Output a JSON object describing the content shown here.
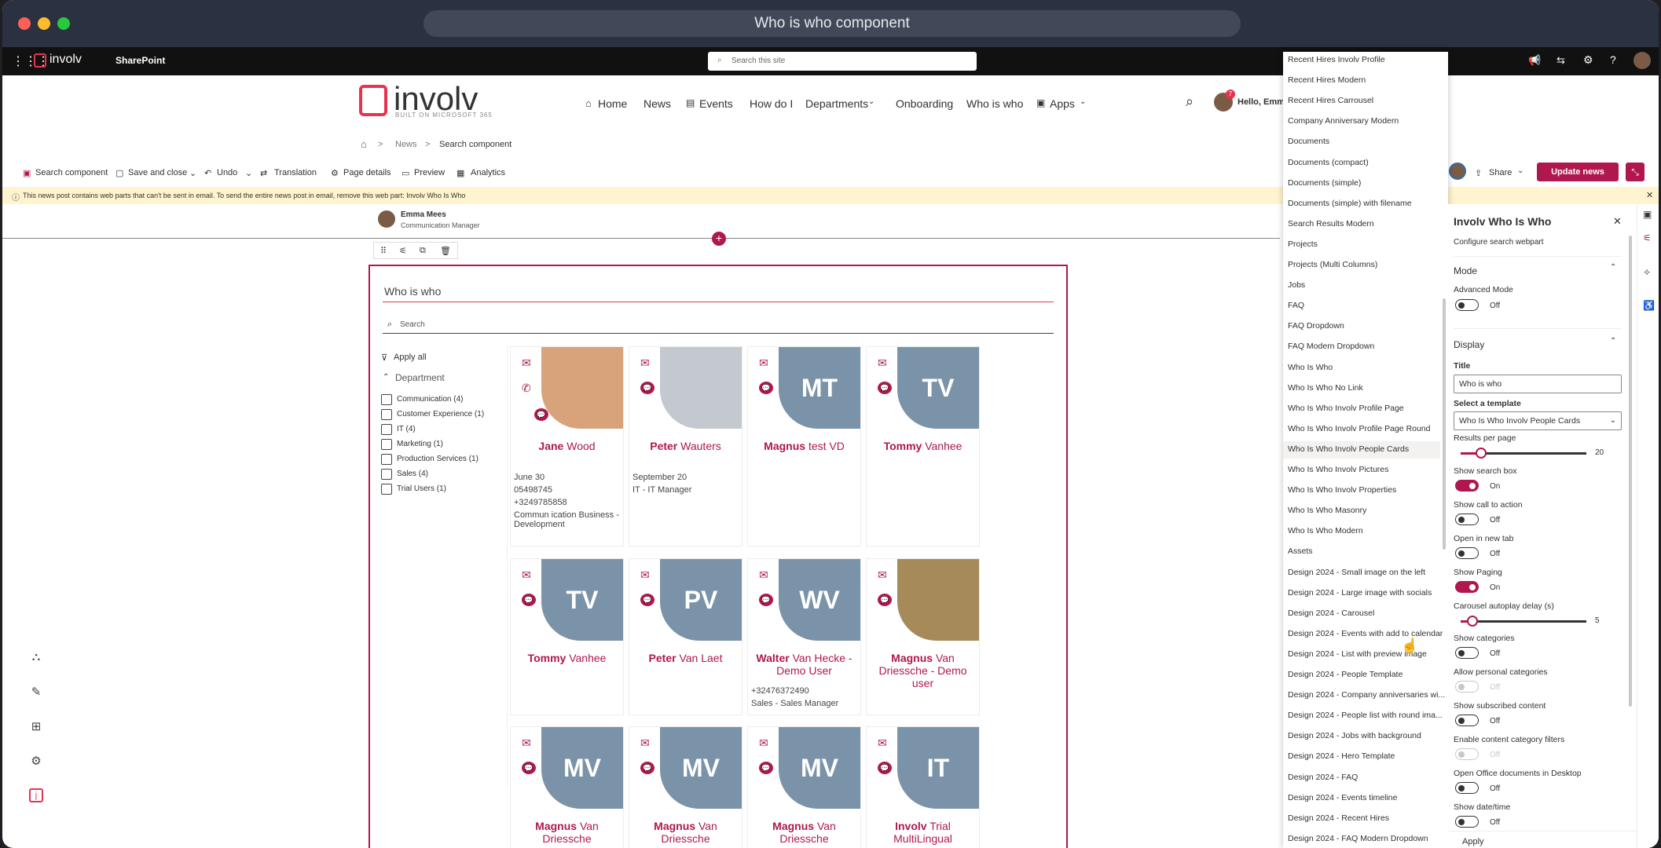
{
  "window": {
    "title": "Who is who component",
    "colors": {
      "red": "#ff5f57",
      "yellow": "#febc2e",
      "green": "#28c840"
    }
  },
  "suite": {
    "brand": "involv",
    "app": "SharePoint",
    "search_placeholder": "Search this site"
  },
  "site": {
    "logo_text": "involv",
    "logo_sub": "BUILT ON MICROSOFT 365",
    "nav": [
      "Home",
      "News",
      "Events",
      "How do I",
      "Departments",
      "Onboarding",
      "Who is who",
      "Apps"
    ],
    "greeting": "Hello, Emma",
    "notif_count": "7"
  },
  "breadcrumb": [
    "News",
    "Search component"
  ],
  "commandbar": {
    "items": [
      "Search component",
      "Save and close",
      "Undo",
      "Translation",
      "Page details",
      "Preview",
      "Analytics"
    ],
    "share": "Share",
    "update": "Update news"
  },
  "warning": "This news post contains web parts that can't be sent in email. To send the entire news post in email, remove this web part: Involv Who Is Who",
  "author": {
    "name": "Emma Mees",
    "role": "Communication Manager"
  },
  "webpart": {
    "title": "Who is who",
    "search_placeholder": "Search",
    "apply_all": "Apply all",
    "filter_heading": "Department",
    "filters": [
      "Communication (4)",
      "Customer Experience (1)",
      "IT (4)",
      "Marketing (1)",
      "Production Services (1)",
      "Sales (4)",
      "Trial Users (1)"
    ]
  },
  "cards": [
    {
      "first": "Jane",
      "last": "Wood",
      "initials": "",
      "info": [
        "June 30",
        "05498745",
        "+3249785858",
        "Commun ication    Business - Development"
      ]
    },
    {
      "first": "Peter",
      "last": "Wauters",
      "initials": "",
      "info": [
        "September 20",
        "IT - IT Manager"
      ]
    },
    {
      "first": "Magnus",
      "last": "test VD",
      "initials": "MT",
      "info": []
    },
    {
      "first": "Tommy",
      "last": "Vanhee",
      "initials": "TV",
      "info": []
    },
    {
      "first": "Tommy",
      "last": "Vanhee",
      "initials": "TV",
      "info": []
    },
    {
      "first": "Peter",
      "last": "Van Laet",
      "initials": "PV",
      "info": []
    },
    {
      "first": "Walter",
      "last": "Van Hecke - Demo User",
      "initials": "WV",
      "info": [
        "+32476372490",
        "Sales - Sales Manager"
      ]
    },
    {
      "first": "Magnus",
      "last": "Van Driessche - Demo user",
      "initials": "",
      "info": []
    },
    {
      "first": "Magnus",
      "last": "Van Driessche",
      "initials": "MV",
      "info": []
    },
    {
      "first": "Magnus",
      "last": "Van Driessche",
      "initials": "MV",
      "info": []
    },
    {
      "first": "Magnus",
      "last": "Van Driessche",
      "initials": "MV",
      "info": []
    },
    {
      "first": "Involv",
      "last": "Trial MultiLingual",
      "initials": "IT",
      "info": []
    }
  ],
  "template_dropdown": [
    "Recent Hires Involv Profile",
    "Recent Hires Modern",
    "Recent Hires Carrousel",
    "Company Anniversary Modern",
    "Documents",
    "Documents (compact)",
    "Documents (simple)",
    "Documents (simple) with filename",
    "Search Results Modern",
    "Projects",
    "Projects (Multi Columns)",
    "Jobs",
    "FAQ",
    "FAQ Dropdown",
    "FAQ Modern Dropdown",
    "Who Is Who",
    "Who Is Who No Link",
    "Who Is Who Involv Profile Page",
    "Who Is Who Involv Profile Page Round",
    "Who Is Who Involv People Cards",
    "Who Is Who Involv Pictures",
    "Who Is Who Involv Properties",
    "Who Is Who Masonry",
    "Who Is Who Modern",
    "Assets",
    "Design 2024 - Small image on the left",
    "Design 2024 - Large image with socials",
    "Design 2024 - Carousel",
    "Design 2024 - Events with add to calendar",
    "Design 2024 - List with preview image",
    "Design 2024 - People Template",
    "Design 2024 - Company anniversaries wi...",
    "Design 2024 - People list with round ima...",
    "Design 2024 - Jobs with background",
    "Design 2024 - Hero Template",
    "Design 2024 - FAQ",
    "Design 2024 - Events timeline",
    "Design 2024 - Recent Hires",
    "Design 2024 - FAQ Modern Dropdown"
  ],
  "selected_template_index": 19,
  "panel": {
    "title": "Involv Who Is Who",
    "subtitle": "Configure search webpart",
    "mode": "Mode",
    "advanced_mode": "Advanced Mode",
    "display": "Display",
    "title_label": "Title",
    "title_value": "Who is who",
    "template_label": "Select a template",
    "template_value": "Who Is Who Involv People Cards",
    "results_label": "Results per page",
    "results_value": "20",
    "carousel_label": "Carousel autoplay delay (s)",
    "carousel_value": "5",
    "apply": "Apply",
    "toggles": [
      {
        "label": "Show search box",
        "state": "On"
      },
      {
        "label": "Show call to action",
        "state": "Off"
      },
      {
        "label": "Open in new tab",
        "state": "Off"
      },
      {
        "label": "Show Paging",
        "state": "On"
      },
      {
        "label": "Show categories",
        "state": "Off"
      },
      {
        "label": "Allow personal categories",
        "state": "Off"
      },
      {
        "label": "Show subscribed content",
        "state": "Off"
      },
      {
        "label": "Enable content category filters",
        "state": "Off"
      },
      {
        "label": "Open Office documents in Desktop",
        "state": "Off"
      },
      {
        "label": "Show date/time",
        "state": "Off"
      }
    ],
    "advanced_state": "Off"
  },
  "accent": "#b0174e"
}
